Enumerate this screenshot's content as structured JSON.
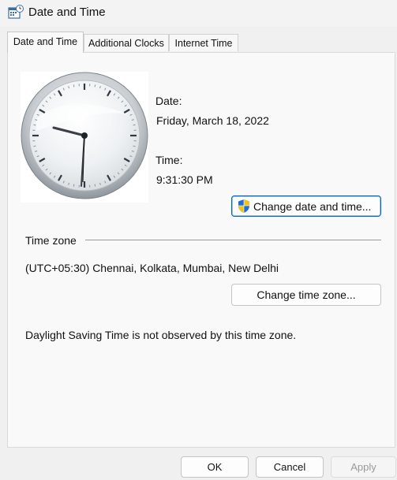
{
  "window": {
    "title": "Date and Time",
    "icon": "date-time-icon"
  },
  "tabs": [
    {
      "label": "Date and Time",
      "active": true
    },
    {
      "label": "Additional Clocks",
      "active": false
    },
    {
      "label": "Internet Time",
      "active": false
    }
  ],
  "date": {
    "label": "Date:",
    "value": "Friday, March 18, 2022"
  },
  "time": {
    "label": "Time:",
    "value": "9:31:30 PM"
  },
  "change_datetime_button": {
    "label": "Change date and time...",
    "icon": "uac-shield-icon"
  },
  "timezone": {
    "group_label": "Time zone",
    "value": "(UTC+05:30) Chennai, Kolkata, Mumbai, New Delhi",
    "change_button": "Change time zone...",
    "dst_note": "Daylight Saving Time is not observed by this time zone."
  },
  "footer": {
    "ok": "OK",
    "cancel": "Cancel",
    "apply": "Apply"
  },
  "colors": {
    "accent": "#0067c0",
    "shield_blue": "#1e6fd9",
    "shield_yellow": "#f2c21a"
  }
}
